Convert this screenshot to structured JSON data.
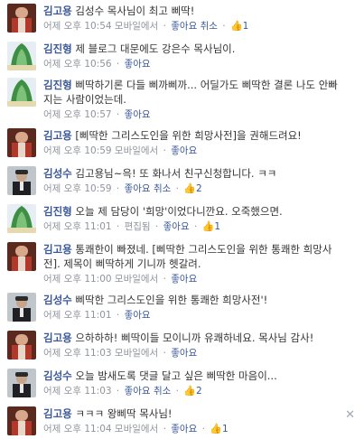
{
  "comments": [
    {
      "author": "김고용",
      "text": "김성수 목사님이 최고 삐딱!",
      "time": "어제 오후 10:54",
      "mobile": "모바일에서",
      "like": "좋아요",
      "cancel": "취소",
      "likes": "1"
    },
    {
      "author": "김진형",
      "text": "제 블로그 대문에도 강은수 목사님이.",
      "time": "어제 오후 10:56",
      "like": "좋아요"
    },
    {
      "author": "김진형",
      "text": "삐딱하기론 다들 삐까삐까... 어딜가도 삐딱한 결론 나도 안빠지는 사람이었는데.",
      "time": "어제 오후 10:57",
      "like": "좋아요"
    },
    {
      "author": "김고용",
      "text": "[삐딱한 그리스도인을 위한 희망사전]을 권해드려요!",
      "time": "어제 오후 10:59",
      "mobile": "모바일에서",
      "like": "좋아요"
    },
    {
      "author": "김성수",
      "text": "김고용님~윽! 또 화나서 친구신청합니다. ㅋㅋ",
      "time": "어제 오후 10:59",
      "like": "좋아요",
      "cancel": "취소",
      "likes": "2"
    },
    {
      "author": "김진형",
      "text": "오늘 제 담당이 '희망'이었다니깐요. 오죽했으면.",
      "time": "어제 오후 11:01",
      "edited": "편집됨",
      "like": "좋아요",
      "likes": "1"
    },
    {
      "author": "김고용",
      "text": "통쾌한이 빠졌네. [삐딱한 그리스도인을 위한 통쾌한 희망사전]. 제목이 삐딱하게 기니까 헷갈려.",
      "time": "어제 오후 11:00",
      "mobile": "모바일에서",
      "like": "좋아요"
    },
    {
      "author": "김성수",
      "text": "삐딱한 그리스도인을 위한 통쾌한 희망사전'!",
      "time": "어제 오후 11:01",
      "like": "좋아요"
    },
    {
      "author": "김고용",
      "text": "으하하하! 삐딱이들 모이니까 유쾌하네요. 목사님 감사!",
      "time": "어제 오후 11:03",
      "mobile": "모바일에서",
      "like": "좋아요"
    },
    {
      "author": "김성수",
      "text": "오늘 밤새도록 댓글 달고 싶은 삐딱한 마음이...",
      "time": "어제 오후 11:03",
      "like": "좋아요",
      "cancel": "취소",
      "likes": "2"
    },
    {
      "author": "김고용",
      "text": "ㅋㅋㅋ 왕삐딱 목사님!",
      "time": "어제 오후 11:04",
      "mobile": "모바일에서",
      "like": "좋아요",
      "likes": "1"
    }
  ],
  "close_glyph": "✕",
  "thumb_icon": "thumbs-up-icon",
  "colors": {
    "link": "#3b5998",
    "meta": "#90949c",
    "border": "#e5e8ef"
  }
}
